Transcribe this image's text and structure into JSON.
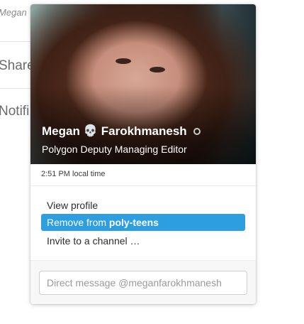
{
  "background": {
    "header_name": "Megan",
    "items": [
      "Share",
      "Notifi"
    ]
  },
  "profile": {
    "first_name": "Megan",
    "emoji_icon": "skull-icon",
    "last_name": "Farokhmanesh",
    "presence": "away",
    "job_title": "Polygon Deputy Managing Editor",
    "local_time": "2:51 PM local time"
  },
  "menu": {
    "view_profile": "View profile",
    "remove_prefix": "Remove from ",
    "remove_channel": "poly-teens",
    "invite": "Invite to a channel …"
  },
  "direct_message": {
    "placeholder": "Direct message @meganfarokhmanesh",
    "value": ""
  },
  "colors": {
    "highlight": "#2d9ee0",
    "footer_bg": "#f7f7f7"
  }
}
